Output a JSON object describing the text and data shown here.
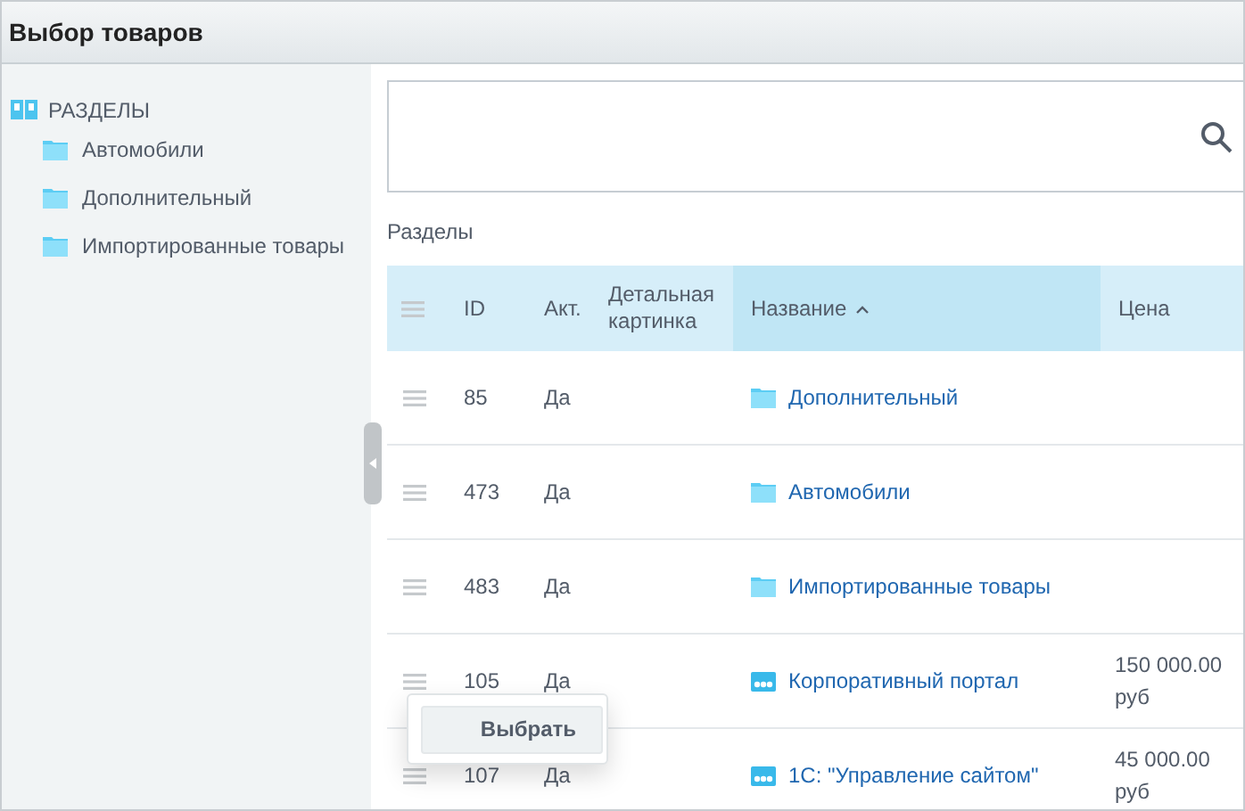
{
  "window": {
    "title": "Выбор товаров"
  },
  "sidebar": {
    "root": "РАЗДЕЛЫ",
    "items": [
      {
        "label": "Автомобили"
      },
      {
        "label": "Дополнительный"
      },
      {
        "label": "Импортированные товары"
      }
    ]
  },
  "section_title": "Разделы",
  "table": {
    "columns": [
      {
        "label": "ID",
        "sorted": false
      },
      {
        "label": "Акт.",
        "sorted": false
      },
      {
        "label": "Детальная картинка",
        "sorted": false
      },
      {
        "label": "Название",
        "sorted": true
      },
      {
        "label": "Цена",
        "sorted": false
      }
    ],
    "rows": [
      {
        "id": "85",
        "active": "Да",
        "kind": "section",
        "name": "Дополнительный"
      },
      {
        "id": "473",
        "active": "Да",
        "kind": "section",
        "name": "Автомобили"
      },
      {
        "id": "483",
        "active": "Да",
        "kind": "section",
        "name": "Импортированные товары"
      },
      {
        "id": "105",
        "active": "Да",
        "kind": "product",
        "name": "Корпоративный портал",
        "price": "150 000.00 руб"
      },
      {
        "id": "107",
        "active": "Да",
        "kind": "product",
        "name": "1С: \"Управление сайтом\"",
        "price": "45 000.00 руб"
      }
    ]
  },
  "popup": {
    "button": "Выбрать"
  }
}
